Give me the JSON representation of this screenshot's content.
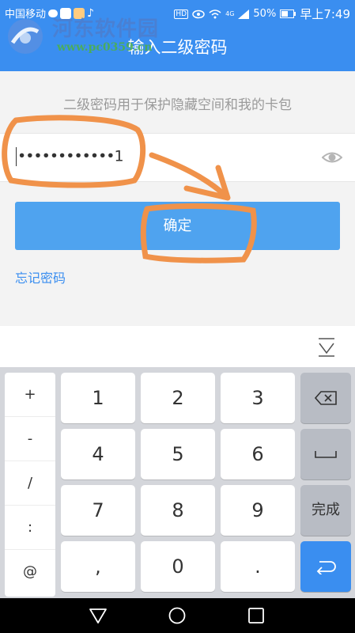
{
  "status_bar": {
    "carrier": "中国移动",
    "network": "4G",
    "battery": "50%",
    "time": "早上7:49"
  },
  "header": {
    "title": "输入二级密码"
  },
  "watermark": {
    "name": "河东软件园",
    "url": "www.pc0359.cn"
  },
  "hint": "二级密码用于保护隐藏空间和我的卡包",
  "password_field": {
    "value": "••••••••••••1"
  },
  "confirm_button": {
    "label": "确定"
  },
  "forgot_link": "忘记密码",
  "keyboard": {
    "symbols": [
      "+",
      "-",
      "/",
      ":",
      "@"
    ],
    "keys": {
      "k1": "1",
      "k2": "2",
      "k3": "3",
      "k4": "4",
      "k5": "5",
      "k6": "6",
      "k7": "7",
      "k8": "8",
      "k9": "9",
      "comma": ",",
      "k0": "0",
      "dot": "."
    },
    "done_label": "完成"
  },
  "colors": {
    "header": "#3a8ef0",
    "button": "#4fa3ef",
    "annotation": "#f0924a"
  }
}
